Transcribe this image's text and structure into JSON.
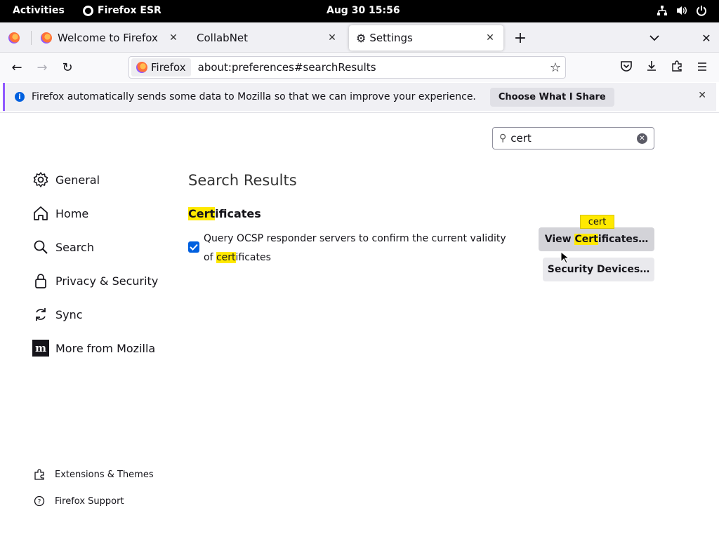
{
  "topbar": {
    "activities": "Activities",
    "app_name": "Firefox ESR",
    "clock": "Aug 30  15:56"
  },
  "tabs": [
    {
      "label": "Welcome to Firefox"
    },
    {
      "label": "CollabNet"
    },
    {
      "label": "Settings"
    }
  ],
  "navbar": {
    "identity_label": "Firefox",
    "url": "about:preferences#searchResults"
  },
  "notice": {
    "message": "Firefox automatically sends some data to Mozilla so that we can improve your experience.",
    "button": "Choose What I Share"
  },
  "search": {
    "value": "cert"
  },
  "sidebar": {
    "items": [
      {
        "label": "General",
        "icon": "gear-icon"
      },
      {
        "label": "Home",
        "icon": "home-icon"
      },
      {
        "label": "Search",
        "icon": "search-icon"
      },
      {
        "label": "Privacy & Security",
        "icon": "lock-icon"
      },
      {
        "label": "Sync",
        "icon": "sync-icon"
      },
      {
        "label": "More from Mozilla",
        "icon": "mozilla-icon"
      }
    ],
    "footer": [
      {
        "label": "Extensions & Themes",
        "icon": "puzzle-icon"
      },
      {
        "label": "Firefox Support",
        "icon": "help-icon"
      }
    ]
  },
  "main": {
    "title": "Search Results",
    "section": {
      "heading_highlight": "Cert",
      "heading_rest": "ificates",
      "checkbox_text_a": "Query OCSP responder servers to confirm the current validity of ",
      "checkbox_text_highlight": "cert",
      "checkbox_text_b": "ificates",
      "checkbox_checked": true,
      "view_btn_a": "View ",
      "view_btn_highlight": "Cert",
      "view_btn_b": "ificates…",
      "devices_btn": "Security Devices…",
      "badge": "cert"
    }
  },
  "colors": {
    "highlight": "#ffe900",
    "accent": "#0060df",
    "notice_accent": "#9059ff"
  }
}
